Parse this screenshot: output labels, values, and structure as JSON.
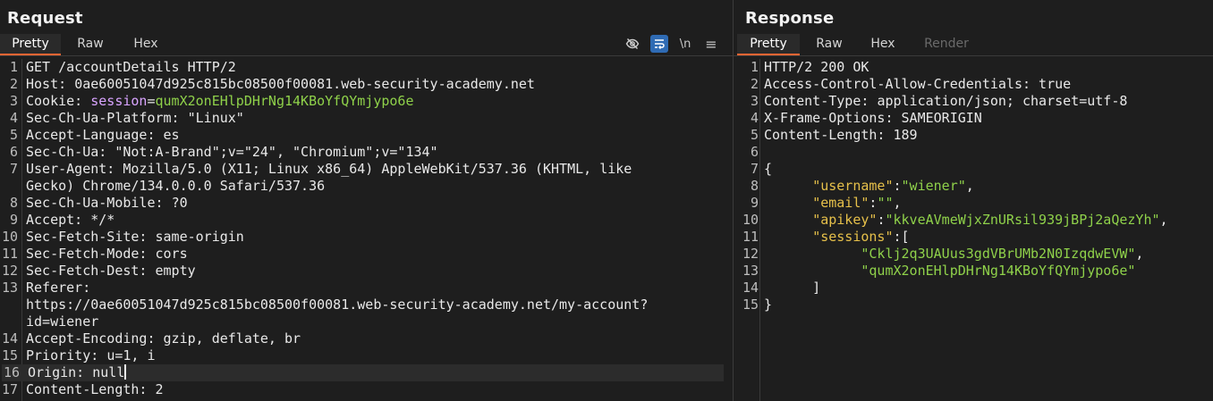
{
  "request": {
    "title": "Request",
    "tabs": [
      "Pretty",
      "Raw",
      "Hex"
    ],
    "active_tab": "Pretty",
    "toolbar": {
      "icons": [
        "eye-slash-icon",
        "wrap-text-icon",
        "newline-icon",
        "menu-icon"
      ],
      "newline_label": "\\n",
      "menu_label": "≡"
    },
    "lines": [
      {
        "n": "1",
        "parts": [
          {
            "t": "GET /accountDetails HTTP/2",
            "c": "val"
          }
        ]
      },
      {
        "n": "2",
        "parts": [
          {
            "t": "Host: ",
            "c": "key"
          },
          {
            "t": "0ae60051047d925c815bc08500f00081.web-security-academy.net",
            "c": "val"
          }
        ]
      },
      {
        "n": "3",
        "parts": [
          {
            "t": "Cookie: ",
            "c": "key"
          },
          {
            "t": "session",
            "c": "cookie-name"
          },
          {
            "t": "=",
            "c": "val"
          },
          {
            "t": "qumX2onEHlpDHrNg14KBoYfQYmjypo6e",
            "c": "cookie-val"
          }
        ]
      },
      {
        "n": "4",
        "parts": [
          {
            "t": "Sec-Ch-Ua-Platform: ",
            "c": "key"
          },
          {
            "t": "\"Linux\"",
            "c": "val"
          }
        ]
      },
      {
        "n": "5",
        "parts": [
          {
            "t": "Accept-Language: ",
            "c": "key"
          },
          {
            "t": "es",
            "c": "val"
          }
        ]
      },
      {
        "n": "6",
        "parts": [
          {
            "t": "Sec-Ch-Ua: ",
            "c": "key"
          },
          {
            "t": "\"Not:A-Brand\";v=\"24\", \"Chromium\";v=\"134\"",
            "c": "val"
          }
        ]
      },
      {
        "n": "7",
        "parts": [
          {
            "t": "User-Agent: ",
            "c": "key"
          },
          {
            "t": "Mozilla/5.0 (X11; Linux x86_64) AppleWebKit/537.36 (KHTML, like",
            "c": "val"
          }
        ]
      },
      {
        "n": "",
        "parts": [
          {
            "t": "Gecko) Chrome/134.0.0.0 Safari/537.36",
            "c": "val"
          }
        ]
      },
      {
        "n": "8",
        "parts": [
          {
            "t": "Sec-Ch-Ua-Mobile: ",
            "c": "key"
          },
          {
            "t": "?0",
            "c": "val"
          }
        ]
      },
      {
        "n": "9",
        "parts": [
          {
            "t": "Accept: ",
            "c": "key"
          },
          {
            "t": "*/*",
            "c": "val"
          }
        ]
      },
      {
        "n": "10",
        "parts": [
          {
            "t": "Sec-Fetch-Site: ",
            "c": "key"
          },
          {
            "t": "same-origin",
            "c": "val"
          }
        ]
      },
      {
        "n": "11",
        "parts": [
          {
            "t": "Sec-Fetch-Mode: ",
            "c": "key"
          },
          {
            "t": "cors",
            "c": "val"
          }
        ]
      },
      {
        "n": "12",
        "parts": [
          {
            "t": "Sec-Fetch-Dest: ",
            "c": "key"
          },
          {
            "t": "empty",
            "c": "val"
          }
        ]
      },
      {
        "n": "13",
        "parts": [
          {
            "t": "Referer: ",
            "c": "key"
          }
        ]
      },
      {
        "n": "",
        "parts": [
          {
            "t": "https://0ae60051047d925c815bc08500f00081.web-security-academy.net/my-account?",
            "c": "val"
          }
        ]
      },
      {
        "n": "",
        "parts": [
          {
            "t": "id=wiener",
            "c": "val"
          }
        ]
      },
      {
        "n": "14",
        "parts": [
          {
            "t": "Accept-Encoding: ",
            "c": "key"
          },
          {
            "t": "gzip, deflate, br",
            "c": "val"
          }
        ]
      },
      {
        "n": "15",
        "parts": [
          {
            "t": "Priority: ",
            "c": "key"
          },
          {
            "t": "u=1, i",
            "c": "val"
          }
        ]
      },
      {
        "n": "16",
        "parts": [
          {
            "t": "Origin: ",
            "c": "key"
          },
          {
            "t": "null",
            "c": "val"
          }
        ],
        "highlight": true,
        "caret": true
      },
      {
        "n": "17",
        "parts": [
          {
            "t": "Content-Length: ",
            "c": "key"
          },
          {
            "t": "2",
            "c": "val"
          }
        ]
      }
    ]
  },
  "response": {
    "title": "Response",
    "tabs": [
      "Pretty",
      "Raw",
      "Hex",
      "Render"
    ],
    "active_tab": "Pretty",
    "disabled_tabs": [
      "Render"
    ],
    "lines": [
      {
        "n": "1",
        "parts": [
          {
            "t": "HTTP/2 200 OK",
            "c": "val"
          }
        ]
      },
      {
        "n": "2",
        "parts": [
          {
            "t": "Access-Control-Allow-Credentials: ",
            "c": "key"
          },
          {
            "t": "true",
            "c": "val"
          }
        ]
      },
      {
        "n": "3",
        "parts": [
          {
            "t": "Content-Type: ",
            "c": "key"
          },
          {
            "t": "application/json; charset=utf-8",
            "c": "val"
          }
        ]
      },
      {
        "n": "4",
        "parts": [
          {
            "t": "X-Frame-Options: ",
            "c": "key"
          },
          {
            "t": "SAMEORIGIN",
            "c": "val"
          }
        ]
      },
      {
        "n": "5",
        "parts": [
          {
            "t": "Content-Length: ",
            "c": "key"
          },
          {
            "t": "189",
            "c": "val"
          }
        ]
      },
      {
        "n": "6",
        "parts": []
      },
      {
        "n": "7",
        "parts": [
          {
            "t": "{",
            "c": "json-punc"
          }
        ]
      },
      {
        "n": "8",
        "parts": [
          {
            "t": "      ",
            "c": "json-punc"
          },
          {
            "t": "\"username\"",
            "c": "json-key"
          },
          {
            "t": ":",
            "c": "json-punc"
          },
          {
            "t": "\"wiener\"",
            "c": "json-str"
          },
          {
            "t": ",",
            "c": "json-punc"
          }
        ]
      },
      {
        "n": "9",
        "parts": [
          {
            "t": "      ",
            "c": "json-punc"
          },
          {
            "t": "\"email\"",
            "c": "json-key"
          },
          {
            "t": ":",
            "c": "json-punc"
          },
          {
            "t": "\"\"",
            "c": "json-str"
          },
          {
            "t": ",",
            "c": "json-punc"
          }
        ]
      },
      {
        "n": "10",
        "parts": [
          {
            "t": "      ",
            "c": "json-punc"
          },
          {
            "t": "\"apikey\"",
            "c": "json-key"
          },
          {
            "t": ":",
            "c": "json-punc"
          },
          {
            "t": "\"kkveAVmeWjxZnURsil939jBPj2aQezYh\"",
            "c": "json-str"
          },
          {
            "t": ",",
            "c": "json-punc"
          }
        ]
      },
      {
        "n": "11",
        "parts": [
          {
            "t": "      ",
            "c": "json-punc"
          },
          {
            "t": "\"sessions\"",
            "c": "json-key"
          },
          {
            "t": ":[",
            "c": "json-punc"
          }
        ]
      },
      {
        "n": "12",
        "parts": [
          {
            "t": "            ",
            "c": "json-punc"
          },
          {
            "t": "\"Cklj2q3UAUus3gdVBrUMb2N0IzqdwEVW\"",
            "c": "json-str"
          },
          {
            "t": ",",
            "c": "json-punc"
          }
        ]
      },
      {
        "n": "13",
        "parts": [
          {
            "t": "            ",
            "c": "json-punc"
          },
          {
            "t": "\"qumX2onEHlpDHrNg14KBoYfQYmjypo6e\"",
            "c": "json-str"
          }
        ]
      },
      {
        "n": "14",
        "parts": [
          {
            "t": "      ]",
            "c": "json-punc"
          }
        ]
      },
      {
        "n": "15",
        "parts": [
          {
            "t": "}",
            "c": "json-punc"
          }
        ]
      }
    ]
  }
}
